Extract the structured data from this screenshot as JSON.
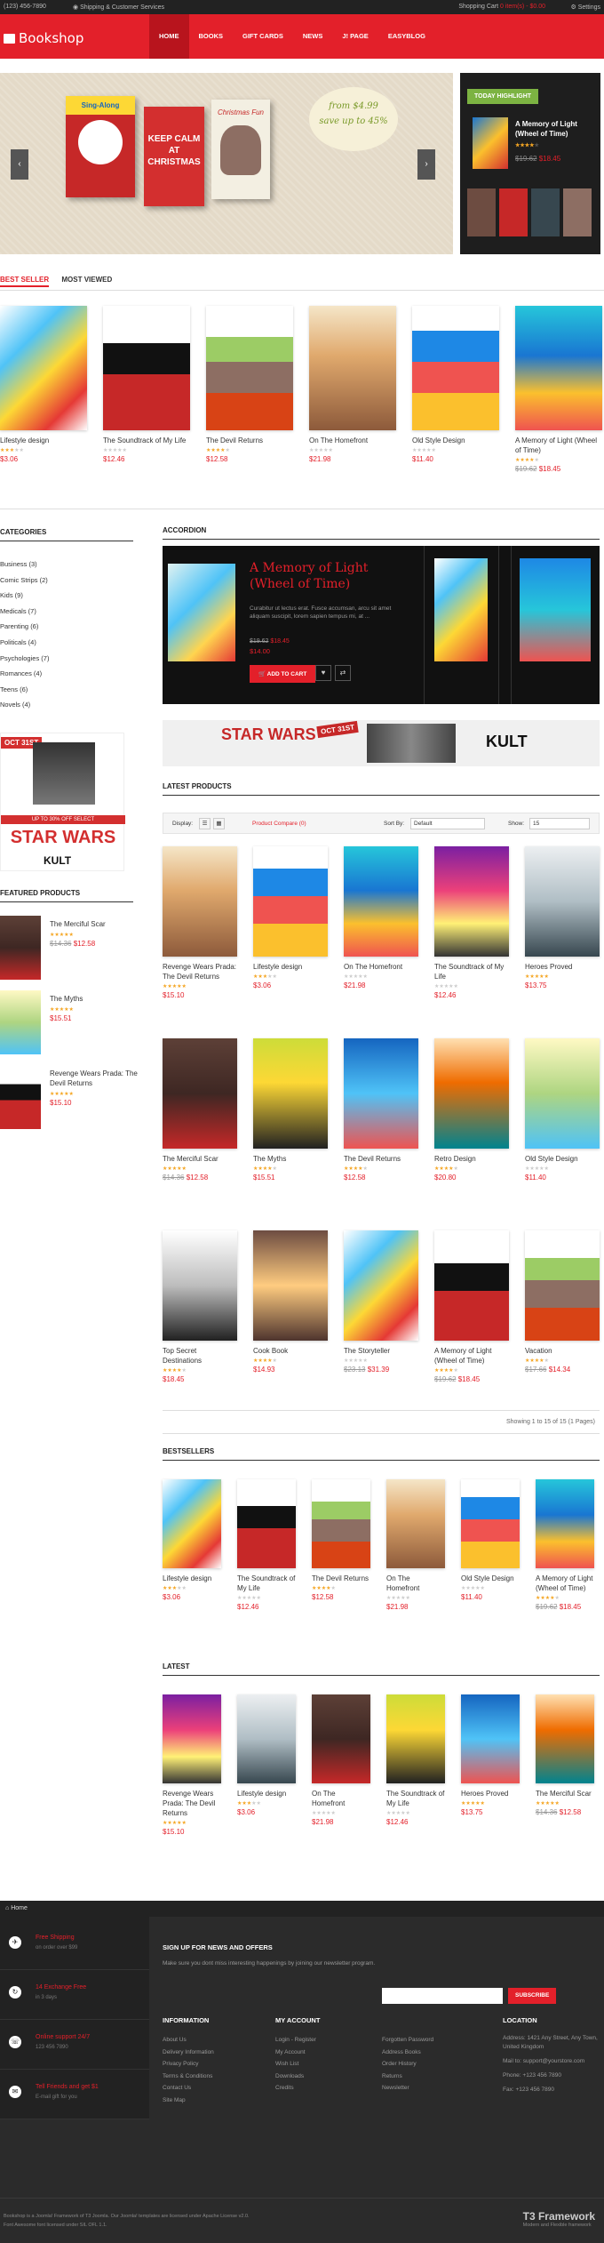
{
  "topbar": {
    "phone": "(123) 456-7890",
    "shipping": "Shipping & Customer Services",
    "cart_label": "Shopping Cart",
    "cart_detail": "0 item(s) - $0.00",
    "settings": "Settings"
  },
  "header": {
    "logo": "Bookshop",
    "nav": [
      "HOME",
      "BOOKS",
      "GIFT CARDS",
      "NEWS",
      "J! PAGE",
      "EASYBLOG"
    ]
  },
  "slider": {
    "bubble_line1": "from $4.99",
    "bubble_line2": "save up to 45%",
    "prev": "‹",
    "next": "›",
    "book1": "Sing-Along",
    "book2": "KEEP CALM AT CHRISTMAS",
    "book3": "Christmas Fun"
  },
  "today": {
    "tag": "TODAY HIGHLIGHT",
    "title": "A Memory of Light (Wheel of Time)",
    "old_price": "$19.62",
    "price": "$18.45"
  },
  "tabs": [
    "BEST SELLER",
    "MOST VIEWED"
  ],
  "best_seller": [
    {
      "name": "Lifestyle design",
      "rating": 3,
      "price": "$3.06",
      "old": ""
    },
    {
      "name": "The Soundtrack of My Life",
      "rating": 0,
      "price": "$12.46",
      "old": ""
    },
    {
      "name": "The Devil Returns",
      "rating": 4,
      "price": "$12.58",
      "old": ""
    },
    {
      "name": "On The Homefront",
      "rating": 0,
      "price": "$21.98",
      "old": ""
    },
    {
      "name": "Old Style Design",
      "rating": 0,
      "price": "$11.40",
      "old": ""
    },
    {
      "name": "A Memory of Light (Wheel of Time)",
      "rating": 4,
      "price": "$18.45",
      "old": "$19.62"
    }
  ],
  "categories_heading": "CATEGORIES",
  "categories": [
    "Business (3)",
    "Comic Strips (2)",
    "Kids (9)",
    "Medicals (7)",
    "Parenting (6)",
    "Politicals (4)",
    "Psychologies (7)",
    "Romances (4)",
    "Teens (6)",
    "Novels (4)"
  ],
  "side_banner": {
    "date": "OCT 31ST",
    "title": "STAR WARS",
    "sub": "UP TO 30% OFF SELECT",
    "brand": "KULT"
  },
  "featured_heading": "FEATURED PRODUCTS",
  "featured": [
    {
      "name": "The Merciful Scar",
      "rating": 5,
      "price": "$12.58",
      "old": "$14.36"
    },
    {
      "name": "The Myths",
      "rating": 4,
      "price": "$15.51",
      "old": ""
    },
    {
      "name": "Revenge Wears Prada: The Devil Returns",
      "rating": 5,
      "price": "$15.10",
      "old": ""
    }
  ],
  "accordion": {
    "heading": "ACCORDION",
    "title": "A Memory of Light (Wheel of Time)",
    "desc": "Curabitur ut lectus erat. Fusce accumsan, arcu sit amet aliquam suscipit, lorem sapien tempus mi, at ...",
    "old_price": "$19.62",
    "price": "$18.45",
    "price2": "$14.00",
    "add_to_cart": "ADD TO CART"
  },
  "wide_banner": {
    "left": "STAR WARS",
    "date": "OCT 31ST",
    "brand": "KULT"
  },
  "latest_heading": "LATEST PRODUCTS",
  "toolbar": {
    "display": "Display:",
    "compare": "Product Compare (0)",
    "sort_label": "Sort By:",
    "sort_value": "Default",
    "show_label": "Show:",
    "show_value": "15"
  },
  "latest_products": [
    {
      "name": "Revenge Wears Prada: The Devil Returns",
      "rating": 5,
      "price": "$15.10",
      "old": ""
    },
    {
      "name": "Lifestyle design",
      "rating": 3,
      "price": "$3.06",
      "old": ""
    },
    {
      "name": "On The Homefront",
      "rating": 0,
      "price": "$21.98",
      "old": ""
    },
    {
      "name": "The Soundtrack of My Life",
      "rating": 0,
      "price": "$12.46",
      "old": ""
    },
    {
      "name": "Heroes Proved",
      "rating": 5,
      "price": "$13.75",
      "old": ""
    },
    {
      "name": "The Merciful Scar",
      "rating": 5,
      "price": "$12.58",
      "old": "$14.36"
    },
    {
      "name": "The Myths",
      "rating": 4,
      "price": "$15.51",
      "old": ""
    },
    {
      "name": "The Devil Returns",
      "rating": 4,
      "price": "$12.58",
      "old": ""
    },
    {
      "name": "Retro Design",
      "rating": 4,
      "price": "$20.80",
      "old": ""
    },
    {
      "name": "Old Style Design",
      "rating": 0,
      "price": "$11.40",
      "old": ""
    },
    {
      "name": "Top Secret Destinations",
      "rating": 4,
      "price": "$18.45",
      "old": ""
    },
    {
      "name": "Cook Book",
      "rating": 4,
      "price": "$14.93",
      "old": ""
    },
    {
      "name": "The Storyteller",
      "rating": 0,
      "price": "$31.39",
      "old": "$23.13"
    },
    {
      "name": "A Memory of Light (Wheel of Time)",
      "rating": 4,
      "price": "$18.45",
      "old": "$19.62"
    },
    {
      "name": "Vacation",
      "rating": 4,
      "price": "$14.34",
      "old": "$17.66"
    }
  ],
  "pager": "Showing 1 to 15 of 15 (1 Pages)",
  "bestsellers_heading": "BESTSELLERS",
  "bestsellers": [
    {
      "name": "Lifestyle design",
      "rating": 3,
      "price": "$3.06",
      "old": ""
    },
    {
      "name": "The Soundtrack of My Life",
      "rating": 0,
      "price": "$12.46",
      "old": ""
    },
    {
      "name": "The Devil Returns",
      "rating": 4,
      "price": "$12.58",
      "old": ""
    },
    {
      "name": "On The Homefront",
      "rating": 0,
      "price": "$21.98",
      "old": ""
    },
    {
      "name": "Old Style Design",
      "rating": 0,
      "price": "$11.40",
      "old": ""
    },
    {
      "name": "A Memory of Light (Wheel of Time)",
      "rating": 4,
      "price": "$18.45",
      "old": "$19.62"
    }
  ],
  "latest_heading2": "LATEST",
  "latest": [
    {
      "name": "Revenge Wears Prada: The Devil Returns",
      "rating": 5,
      "price": "$15.10",
      "old": ""
    },
    {
      "name": "Lifestyle design",
      "rating": 3,
      "price": "$3.06",
      "old": ""
    },
    {
      "name": "On The Homefront",
      "rating": 0,
      "price": "$21.98",
      "old": ""
    },
    {
      "name": "The Soundtrack of My Life",
      "rating": 0,
      "price": "$12.46",
      "old": ""
    },
    {
      "name": "Heroes Proved",
      "rating": 5,
      "price": "$13.75",
      "old": ""
    },
    {
      "name": "The Merciful Scar",
      "rating": 5,
      "price": "$12.58",
      "old": "$14.36"
    }
  ],
  "breadcrumb": "Home",
  "footer": {
    "features": [
      {
        "title": "Free Shipping",
        "sub": "on order over $99"
      },
      {
        "title": "14 Exchange Free",
        "sub": "in 3 days"
      },
      {
        "title": "Online support 24/7",
        "sub": "123 456 7890"
      },
      {
        "title": "Tell Friends and get $1",
        "sub": "E-mail gift for you"
      }
    ],
    "newsletter_heading": "SIGN UP FOR NEWS AND OFFERS",
    "newsletter_text": "Make sure you dont miss interesting happenings by joining our newsletter program.",
    "subscribe": "SUBSCRIBE",
    "info_heading": "INFORMATION",
    "info": [
      "About Us",
      "Delivery Information",
      "Privacy Policy",
      "Terms & Conditions",
      "Contact Us",
      "Site Map"
    ],
    "account_heading": "MY ACCOUNT",
    "account1": [
      "Login - Register",
      "My Account",
      "Wish List",
      "Downloads",
      "Credits"
    ],
    "account2": [
      "Forgotten Password",
      "Address Books",
      "Order History",
      "Returns",
      "Newsletter"
    ],
    "location_heading": "LOCATION",
    "location": [
      "Address: 1421 Any Street, Any Town, United Kingdom",
      "Mail to: support@yourstore.com",
      "Phone: +123 456 7890",
      "Fax: +123 456 7890"
    ],
    "copyright1": "Bookshop is a Joomla! Framework of T3 Joomla. Our Joomla! templates are licensed under Apache License v2.0.",
    "copyright2": "Font Awesome font licensed under SIL OFL 1.1.",
    "brand": "T3 Framework",
    "brand_sub": "Modern and Flexible framework"
  },
  "colors": {
    "accent": "#e3202a",
    "dark": "#222222",
    "star": "#f5a623"
  }
}
